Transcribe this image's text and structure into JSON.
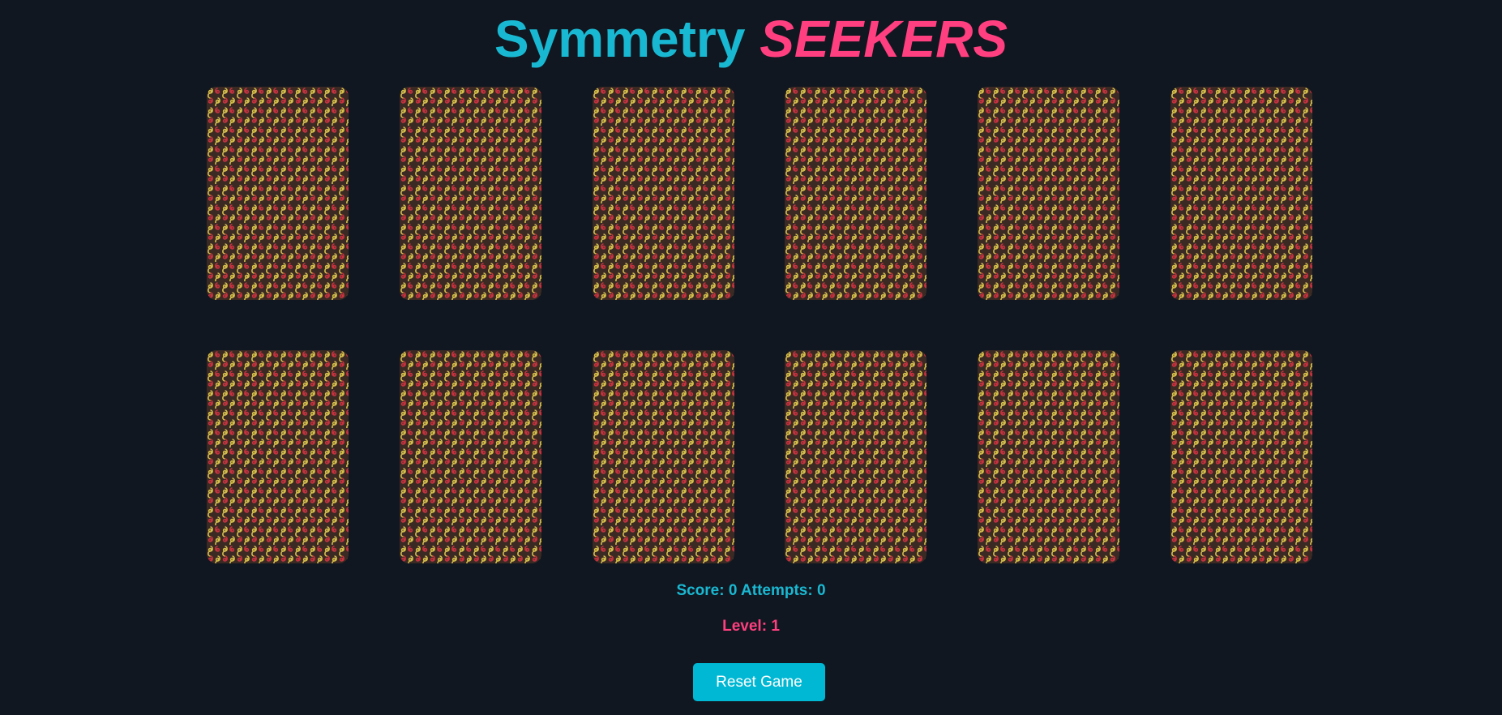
{
  "title": {
    "word1": "Symmetry",
    "word2": "SEEKERS"
  },
  "cards": [
    {
      "state": "face-down"
    },
    {
      "state": "face-down"
    },
    {
      "state": "face-down"
    },
    {
      "state": "face-down"
    },
    {
      "state": "face-down"
    },
    {
      "state": "face-down"
    },
    {
      "state": "face-down"
    },
    {
      "state": "face-down"
    },
    {
      "state": "face-down"
    },
    {
      "state": "face-down"
    },
    {
      "state": "face-down"
    },
    {
      "state": "face-down"
    }
  ],
  "stats": {
    "score_label": "Score:",
    "score": "0",
    "attempts_label": "Attempts:",
    "attempts": "0",
    "level_label": "Level:",
    "level": "1"
  },
  "reset_label": "Reset Game",
  "colors": {
    "background": "#111720",
    "accent_cyan": "#19b8d2",
    "accent_pink": "#ff3f7f",
    "card_back": "#3b2a24",
    "swirl_yellow": "#d6c04a",
    "swirl_red": "#c8323f",
    "button": "#00b8d4"
  }
}
